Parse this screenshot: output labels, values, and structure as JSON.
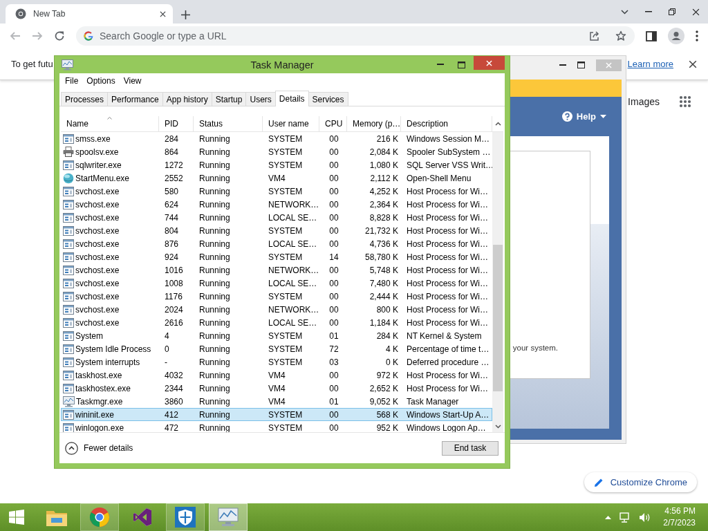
{
  "browser": {
    "tab": {
      "title": "New Tab",
      "selected": true
    },
    "address_bar": {
      "placeholder": "Search Google or type a URL"
    },
    "infobar": {
      "text": "To get futu",
      "link": "Learn more"
    },
    "page": {
      "links": [
        "Images"
      ],
      "customize_button": "Customize Chrome"
    }
  },
  "background_window": {
    "help_label": "Help",
    "text": "your system."
  },
  "task_manager": {
    "title": "Task Manager",
    "menu": [
      "File",
      "Options",
      "View"
    ],
    "tabs": [
      {
        "label": "Processes",
        "selected": false
      },
      {
        "label": "Performance",
        "selected": false
      },
      {
        "label": "App history",
        "selected": false
      },
      {
        "label": "Startup",
        "selected": false
      },
      {
        "label": "Users",
        "selected": false
      },
      {
        "label": "Details",
        "selected": true
      },
      {
        "label": "Services",
        "selected": false
      }
    ],
    "columns": [
      {
        "label": "Name",
        "sorted": true
      },
      {
        "label": "PID",
        "sorted": false
      },
      {
        "label": "Status",
        "sorted": false
      },
      {
        "label": "User name",
        "sorted": false
      },
      {
        "label": "CPU",
        "sorted": false
      },
      {
        "label": "Memory (p…",
        "sorted": false
      },
      {
        "label": "Description",
        "sorted": false
      }
    ],
    "rows": [
      {
        "kind": "app",
        "name": "smss.exe",
        "pid": "284",
        "status": "Running",
        "user": "SYSTEM",
        "cpu": "00",
        "memory": "216 K",
        "description": "Windows Session M…",
        "selected": false
      },
      {
        "kind": "printer",
        "name": "spoolsv.exe",
        "pid": "864",
        "status": "Running",
        "user": "SYSTEM",
        "cpu": "00",
        "memory": "2,084 K",
        "description": "Spooler SubSystem …",
        "selected": false
      },
      {
        "kind": "app",
        "name": "sqlwriter.exe",
        "pid": "1272",
        "status": "Running",
        "user": "SYSTEM",
        "cpu": "00",
        "memory": "1,080 K",
        "description": "SQL Server VSS Writ…",
        "selected": false
      },
      {
        "kind": "shell",
        "name": "StartMenu.exe",
        "pid": "2552",
        "status": "Running",
        "user": "VM4",
        "cpu": "00",
        "memory": "2,112 K",
        "description": "Open-Shell Menu",
        "selected": false
      },
      {
        "kind": "app",
        "name": "svchost.exe",
        "pid": "580",
        "status": "Running",
        "user": "SYSTEM",
        "cpu": "00",
        "memory": "4,252 K",
        "description": "Host Process for Wi…",
        "selected": false
      },
      {
        "kind": "app",
        "name": "svchost.exe",
        "pid": "624",
        "status": "Running",
        "user": "NETWORK…",
        "cpu": "00",
        "memory": "2,364 K",
        "description": "Host Process for Wi…",
        "selected": false
      },
      {
        "kind": "app",
        "name": "svchost.exe",
        "pid": "744",
        "status": "Running",
        "user": "LOCAL SE…",
        "cpu": "00",
        "memory": "8,828 K",
        "description": "Host Process for Wi…",
        "selected": false
      },
      {
        "kind": "app",
        "name": "svchost.exe",
        "pid": "804",
        "status": "Running",
        "user": "SYSTEM",
        "cpu": "00",
        "memory": "21,732 K",
        "description": "Host Process for Wi…",
        "selected": false
      },
      {
        "kind": "app",
        "name": "svchost.exe",
        "pid": "876",
        "status": "Running",
        "user": "LOCAL SE…",
        "cpu": "00",
        "memory": "4,736 K",
        "description": "Host Process for Wi…",
        "selected": false
      },
      {
        "kind": "app",
        "name": "svchost.exe",
        "pid": "924",
        "status": "Running",
        "user": "SYSTEM",
        "cpu": "14",
        "memory": "58,780 K",
        "description": "Host Process for Wi…",
        "selected": false
      },
      {
        "kind": "app",
        "name": "svchost.exe",
        "pid": "1016",
        "status": "Running",
        "user": "NETWORK…",
        "cpu": "00",
        "memory": "5,748 K",
        "description": "Host Process for Wi…",
        "selected": false
      },
      {
        "kind": "app",
        "name": "svchost.exe",
        "pid": "1008",
        "status": "Running",
        "user": "LOCAL SE…",
        "cpu": "00",
        "memory": "7,480 K",
        "description": "Host Process for Wi…",
        "selected": false
      },
      {
        "kind": "app",
        "name": "svchost.exe",
        "pid": "1176",
        "status": "Running",
        "user": "SYSTEM",
        "cpu": "00",
        "memory": "2,444 K",
        "description": "Host Process for Wi…",
        "selected": false
      },
      {
        "kind": "app",
        "name": "svchost.exe",
        "pid": "2024",
        "status": "Running",
        "user": "NETWORK…",
        "cpu": "00",
        "memory": "800 K",
        "description": "Host Process for Wi…",
        "selected": false
      },
      {
        "kind": "app",
        "name": "svchost.exe",
        "pid": "2616",
        "status": "Running",
        "user": "LOCAL SE…",
        "cpu": "00",
        "memory": "1,184 K",
        "description": "Host Process for Wi…",
        "selected": false
      },
      {
        "kind": "app",
        "name": "System",
        "pid": "4",
        "status": "Running",
        "user": "SYSTEM",
        "cpu": "01",
        "memory": "284 K",
        "description": "NT Kernel & System",
        "selected": false
      },
      {
        "kind": "app",
        "name": "System Idle Process",
        "pid": "0",
        "status": "Running",
        "user": "SYSTEM",
        "cpu": "72",
        "memory": "4 K",
        "description": "Percentage of time t…",
        "selected": false
      },
      {
        "kind": "app",
        "name": "System interrupts",
        "pid": "-",
        "status": "Running",
        "user": "SYSTEM",
        "cpu": "03",
        "memory": "0 K",
        "description": "Deferred procedure …",
        "selected": false
      },
      {
        "kind": "app",
        "name": "taskhost.exe",
        "pid": "4032",
        "status": "Running",
        "user": "VM4",
        "cpu": "00",
        "memory": "972 K",
        "description": "Host Process for Wi…",
        "selected": false
      },
      {
        "kind": "app",
        "name": "taskhostex.exe",
        "pid": "2344",
        "status": "Running",
        "user": "VM4",
        "cpu": "00",
        "memory": "2,652 K",
        "description": "Host Process for Wi…",
        "selected": false
      },
      {
        "kind": "monitor",
        "name": "Taskmgr.exe",
        "pid": "3860",
        "status": "Running",
        "user": "VM4",
        "cpu": "01",
        "memory": "9,052 K",
        "description": "Task Manager",
        "selected": false
      },
      {
        "kind": "app",
        "name": "wininit.exe",
        "pid": "412",
        "status": "Running",
        "user": "SYSTEM",
        "cpu": "00",
        "memory": "568 K",
        "description": "Windows Start-Up A…",
        "selected": true
      },
      {
        "kind": "app",
        "name": "winlogon.exe",
        "pid": "472",
        "status": "Running",
        "user": "SYSTEM",
        "cpu": "00",
        "memory": "952 K",
        "description": "Windows Logon Ap…",
        "selected": false
      }
    ],
    "footer": {
      "toggle": "Fewer details",
      "button": "End task"
    }
  },
  "taskbar": {
    "apps": [
      {
        "kind": "folder",
        "running": false,
        "selected": false
      },
      {
        "kind": "browser",
        "running": true,
        "selected": false
      },
      {
        "kind": "studio",
        "running": false,
        "selected": false
      },
      {
        "kind": "shield",
        "running": true,
        "selected": false
      },
      {
        "kind": "monitor",
        "running": true,
        "selected": true
      }
    ],
    "clock": {
      "time": "4:56 PM",
      "date": "2/7/2023"
    }
  }
}
